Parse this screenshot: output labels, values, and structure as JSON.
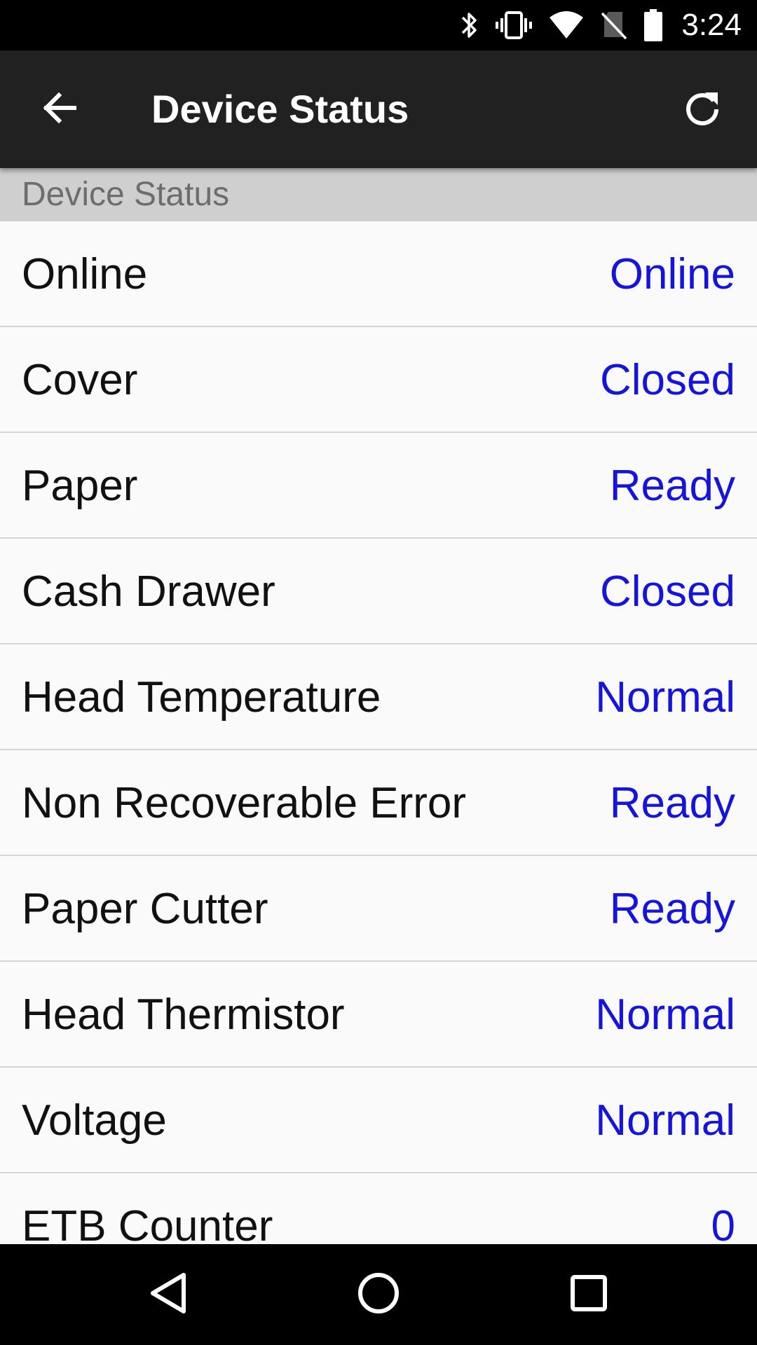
{
  "status_bar": {
    "time": "3:24",
    "icons": [
      "bluetooth-icon",
      "vibrate-icon",
      "wifi-icon",
      "no-sim-icon",
      "battery-icon"
    ]
  },
  "app_bar": {
    "title": "Device Status",
    "back_icon": "arrow-back-icon",
    "refresh_icon": "refresh-icon"
  },
  "section": {
    "header": "Device Status"
  },
  "rows": [
    {
      "label": "Online",
      "value": "Online"
    },
    {
      "label": "Cover",
      "value": "Closed"
    },
    {
      "label": "Paper",
      "value": "Ready"
    },
    {
      "label": "Cash Drawer",
      "value": "Closed"
    },
    {
      "label": "Head Temperature",
      "value": "Normal"
    },
    {
      "label": "Non Recoverable Error",
      "value": "Ready"
    },
    {
      "label": "Paper Cutter",
      "value": "Ready"
    },
    {
      "label": "Head Thermistor",
      "value": "Normal"
    },
    {
      "label": "Voltage",
      "value": "Normal"
    },
    {
      "label": "ETB Counter",
      "value": "0"
    }
  ],
  "nav_bar": {
    "icons": [
      "nav-back-icon",
      "nav-home-icon",
      "nav-recents-icon"
    ]
  },
  "colors": {
    "status_bar": "#000000",
    "app_bar": "#212121",
    "section_header": "#cfcfcf",
    "value_text": "#1414dc",
    "background": "#fafafa"
  }
}
